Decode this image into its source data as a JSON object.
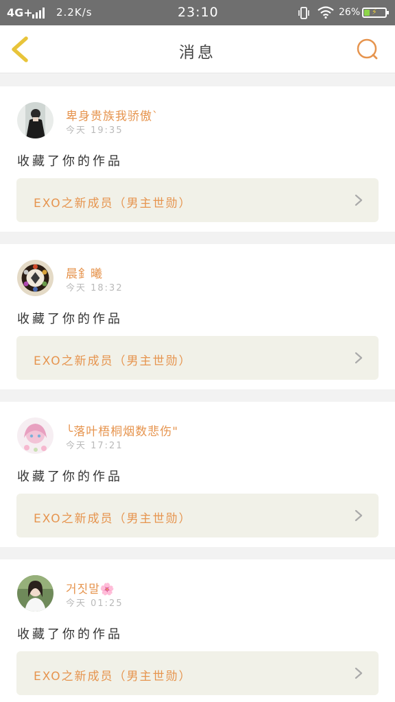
{
  "status_bar": {
    "network": "4G+",
    "speed": "2.2K/s",
    "time": "23:10",
    "battery": "26%",
    "battery_level": 0.26,
    "icons": [
      "signal-icon",
      "vibrate-icon",
      "wifi-icon",
      "battery-icon"
    ]
  },
  "header": {
    "title": "消息",
    "back_icon": "chevron-left-icon",
    "search_icon": "search-icon"
  },
  "colors": {
    "accent": "#e6944e",
    "back_icon": "#e8c43a",
    "card_link_bg": "#f1f1e8"
  },
  "messages": [
    {
      "username": "卑身贵族我骄傲`",
      "time": "今天 19:35",
      "action": "收藏了你的作品",
      "work_title": "EXO之新成员（男主世勋）"
    },
    {
      "username": "晨釒曦",
      "time": "今天 18:32",
      "action": "收藏了你的作品",
      "work_title": "EXO之新成员（男主世勋）"
    },
    {
      "username": "╰落叶梧桐烟数悲伤\"",
      "time": "今天 17:21",
      "action": "收藏了你的作品",
      "work_title": "EXO之新成员（男主世勋）"
    },
    {
      "username": "거짓말🌸",
      "time": "今天 01:25",
      "action": "收藏了你的作品",
      "work_title": "EXO之新成员（男主世勋）"
    }
  ]
}
